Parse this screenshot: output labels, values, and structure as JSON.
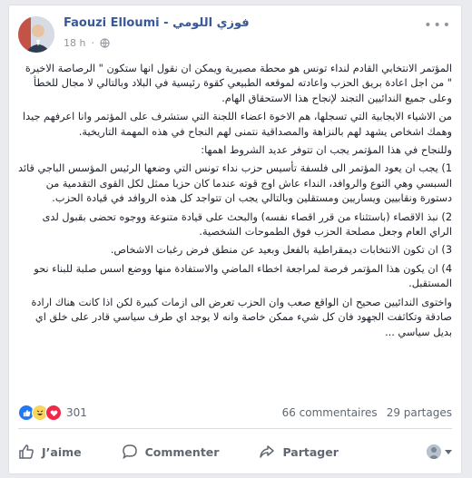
{
  "post": {
    "author": "Faouzi Elloumi - فوزي اللومي",
    "time": "18 h",
    "privacy_icon": "globe-icon",
    "paragraphs": [
      "المؤتمر الانتخابي القادم لنداء تونس هو محطة مصيرية ويمكن ان نقول انها ستكون \" الرصاصة الاخيرة \" من اجل اعادة بريق الحزب واعادته لموقعه الطبيعي كقوة رئيسية في البلاد وبالتالي لا مجال للخطأ وعلى جميع الندائيين التجند لإنجاح هذا الاستحقاق الهام.",
      "من الاشياء الايجابية التي تسجلها، هم الاخوة اعضاء اللجنة التي ستشرف على المؤتمر وانا اعرفهم جيدا وهمك اشخاص يشهد لهم بالنزاهة والمصداقية نتمنى لهم النجاح في هذه المهمة التاريخية.",
      "وللنجاح في هذا المؤتمر يجب ان تتوفر عديد الشروط اهمها:",
      "1) يجب ان يعود المؤتمر الى فلسفة تأسيس حزب نداء تونس التي وضعها الرئيس المؤسس الباجي قائد السبسي وهي التوع والروافد، النداء عاش اوج قوته عندما كان حزبا ممثل لكل القوى التقدمية من دستورة ونقابيين ويساريين ومستقلين وبالتالي يجب ان تتواجد كل هذه الروافد في قيادة الحزب.",
      "2) نبذ الاقصاء (باستثناء من قرر اقصاء نفسه) والبحث على قيادة متنوعة ووجوه تحضى بقبول لدى الراي العام وجعل مصلحة الحزب فوق الطموحات الشخصية.",
      "3) ان تكون الانتخابات ديمقراطية بالفعل وبعيد عن منطق فرض رغبات الاشخاص.",
      "4) ان يكون هذا المؤتمر فرصة لمراجعة اخطاء الماضي والاستفادة منها ووضع اسس صلبة للبناء نحو المستقبل.",
      "واختوى الندائيين صحيح ان الواقع صعب وان الحزب تعرض الى ازمات كبيرة لكن اذا كانت هناك ارادة صادقة وتكاثفت الجهود فان كل شيء ممكن خاصة وانه لا يوجد اي طرف سياسي قادر على خلق اي بديل سياسي ..."
    ]
  },
  "stats": {
    "reaction_icons": [
      "like-icon",
      "haha-icon",
      "love-icon"
    ],
    "reaction_count": "301",
    "comments": "66 commentaires",
    "shares": "29 partages"
  },
  "actions": {
    "like": "J’aime",
    "comment": "Commenter",
    "share": "Partager"
  }
}
